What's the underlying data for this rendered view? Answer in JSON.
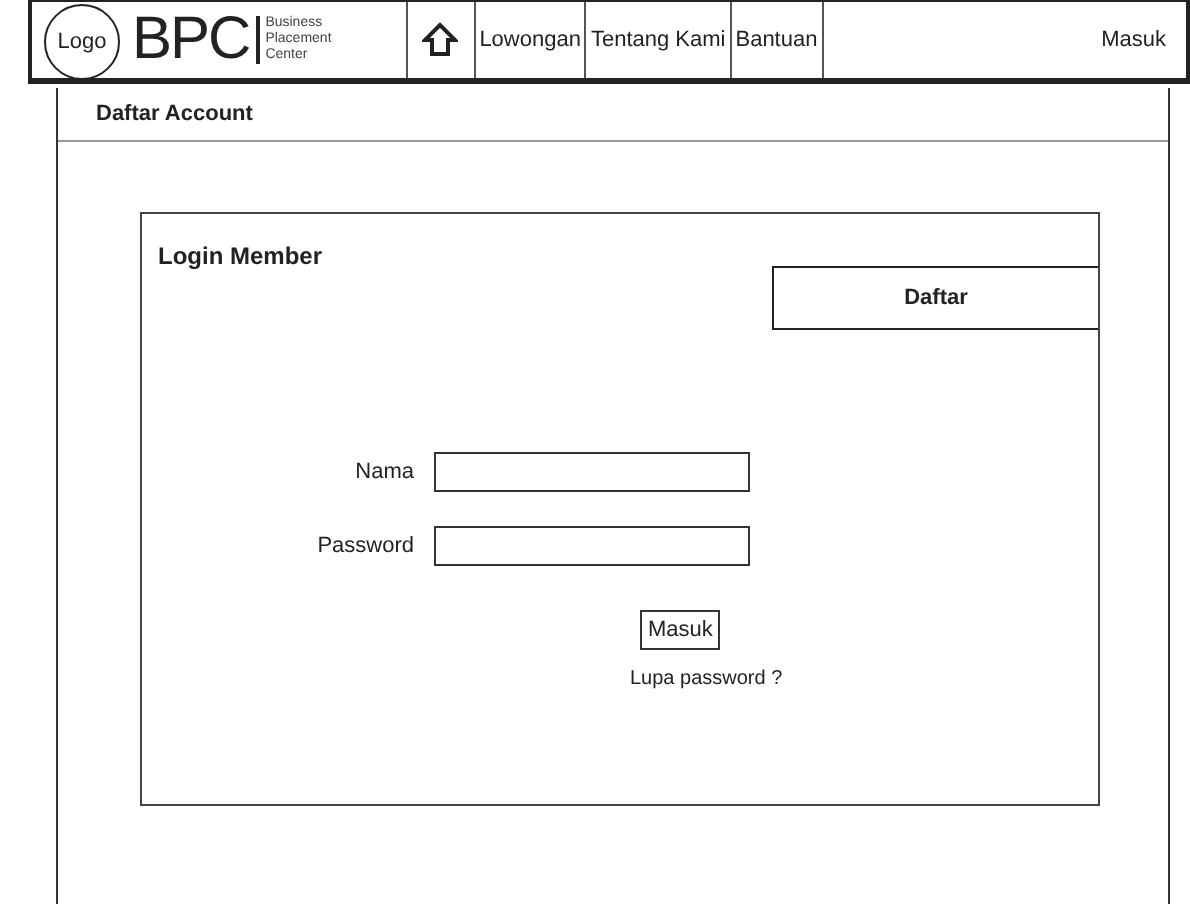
{
  "header": {
    "logo": "Logo",
    "brand": "BPC",
    "tagline": [
      "Business",
      "Placement",
      "Center"
    ],
    "nav": [
      "Lowongan",
      "Tentang Kami",
      "Bantuan"
    ],
    "login": "Masuk"
  },
  "page": {
    "title": "Daftar Account"
  },
  "card": {
    "title": "Login Member",
    "register_button": "Daftar",
    "fields": [
      {
        "label": "Nama"
      },
      {
        "label": "Password"
      }
    ],
    "submit": "Masuk",
    "forgot": "Lupa password ?"
  }
}
